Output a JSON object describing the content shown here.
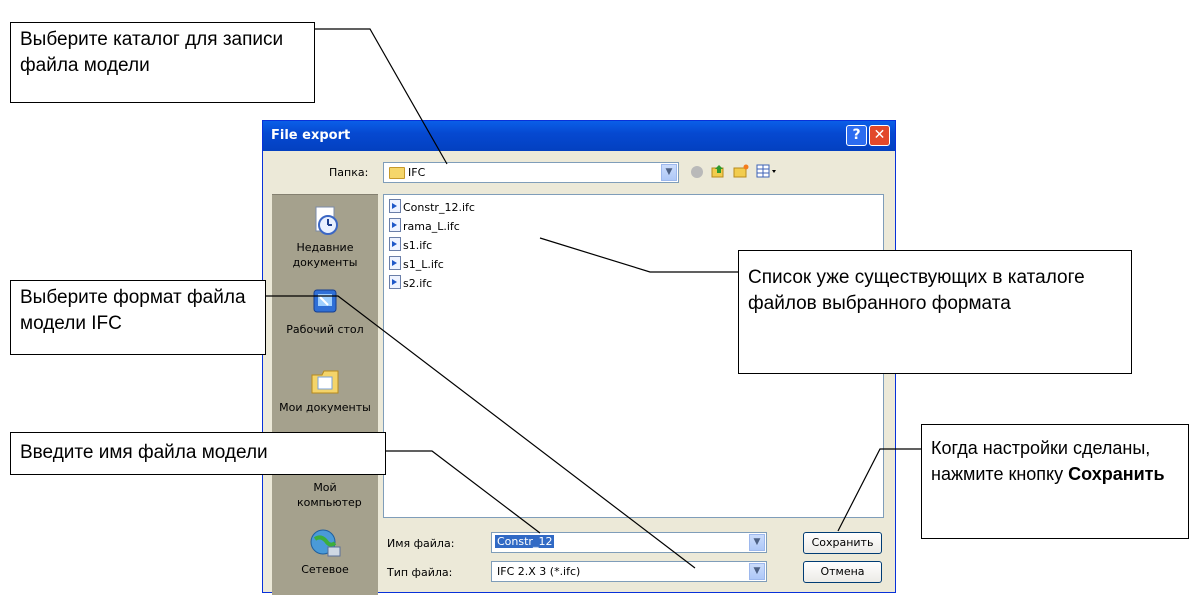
{
  "dialog": {
    "title": "File export",
    "help_symbol": "?",
    "close_symbol": "✕",
    "folder_label": "Папка:",
    "folder_value": "IFC",
    "places": [
      {
        "label": "Недавние документы",
        "icon": "recent-documents-icon"
      },
      {
        "label": "Рабочий стол",
        "icon": "desktop-icon"
      },
      {
        "label": "Мои документы",
        "icon": "my-documents-icon"
      },
      {
        "label": "Мой компьютер",
        "icon": "my-computer-icon"
      },
      {
        "label": "Сетевое",
        "icon": "network-icon"
      }
    ],
    "files": [
      "Constr_12.ifc",
      "rama_L.ifc",
      "s1.ifc",
      "s1_L.ifc",
      "s2.ifc"
    ],
    "filename_label": "Имя файла:",
    "filename_value": "Constr_12",
    "filetype_label": "Тип файла:",
    "filetype_value": "IFC 2.X 3 (*.ifc)",
    "save_label": "Сохранить",
    "cancel_label": "Отмена"
  },
  "callouts": {
    "folder_hint": "Выберите каталог для записи файла модели",
    "format_hint": "Выберите формат файла модели IFC",
    "filename_hint": "Введите имя файла модели",
    "list_hint": "Список уже существующих в каталоге файлов выбранного формата",
    "save_hint_prefix": "Когда настройки сделаны, нажмите кнопку",
    "save_hint_bold": "Сохранить"
  },
  "colors": {
    "titlebar": "#0649d1",
    "dialog_bg": "#ece9d8",
    "places_bg": "#a5a18d",
    "selection": "#316ac5"
  }
}
